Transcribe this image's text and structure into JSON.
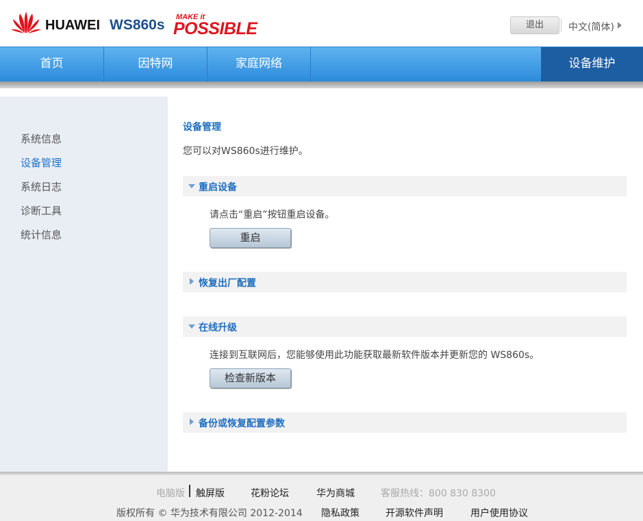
{
  "header": {
    "brand": "HUAWEI",
    "model": "WS860s",
    "slogan_top": "MAKE it",
    "slogan_main": "POSSIBLE",
    "logout_label": "退出",
    "language_label": "中文(简体)"
  },
  "nav": {
    "items": [
      {
        "label": "首页"
      },
      {
        "label": "因特网"
      },
      {
        "label": "家庭网络"
      },
      {
        "label": "设备维护"
      }
    ],
    "active_index": 3
  },
  "sidebar": {
    "items": [
      {
        "label": "系统信息"
      },
      {
        "label": "设备管理"
      },
      {
        "label": "系统日志"
      },
      {
        "label": "诊断工具"
      },
      {
        "label": "统计信息"
      }
    ],
    "active_index": 1
  },
  "main": {
    "title": "设备管理",
    "description": "您可以对WS860s进行维护。",
    "sections": [
      {
        "title": "重启设备",
        "expanded": true,
        "text": "请点击“重启”按钮重启设备。",
        "button": "重启"
      },
      {
        "title": "恢复出厂配置",
        "expanded": false
      },
      {
        "title": "在线升级",
        "expanded": true,
        "text": "连接到互联网后，您能够使用此功能获取最新软件版本并更新您的 WS860s。",
        "button": "检查新版本"
      },
      {
        "title": "备份或恢复配置参数",
        "expanded": false
      }
    ]
  },
  "footer": {
    "desktop_label": "电脑版",
    "touch_label": "触屏版",
    "forum_label": "花粉论坛",
    "store_label": "华为商城",
    "hotline_label": "客服热线：800 830 8300",
    "copyright": "版权所有 © 华为技术有限公司 2012-2014",
    "privacy_label": "隐私政策",
    "opensource_label": "开源软件声明",
    "agreement_label": "用户使用协议"
  },
  "colors": {
    "nav_blue": "#3a97e3",
    "nav_active": "#1d5ea3",
    "accent_blue": "#1f6fbf",
    "brand_red": "#e0141e"
  }
}
